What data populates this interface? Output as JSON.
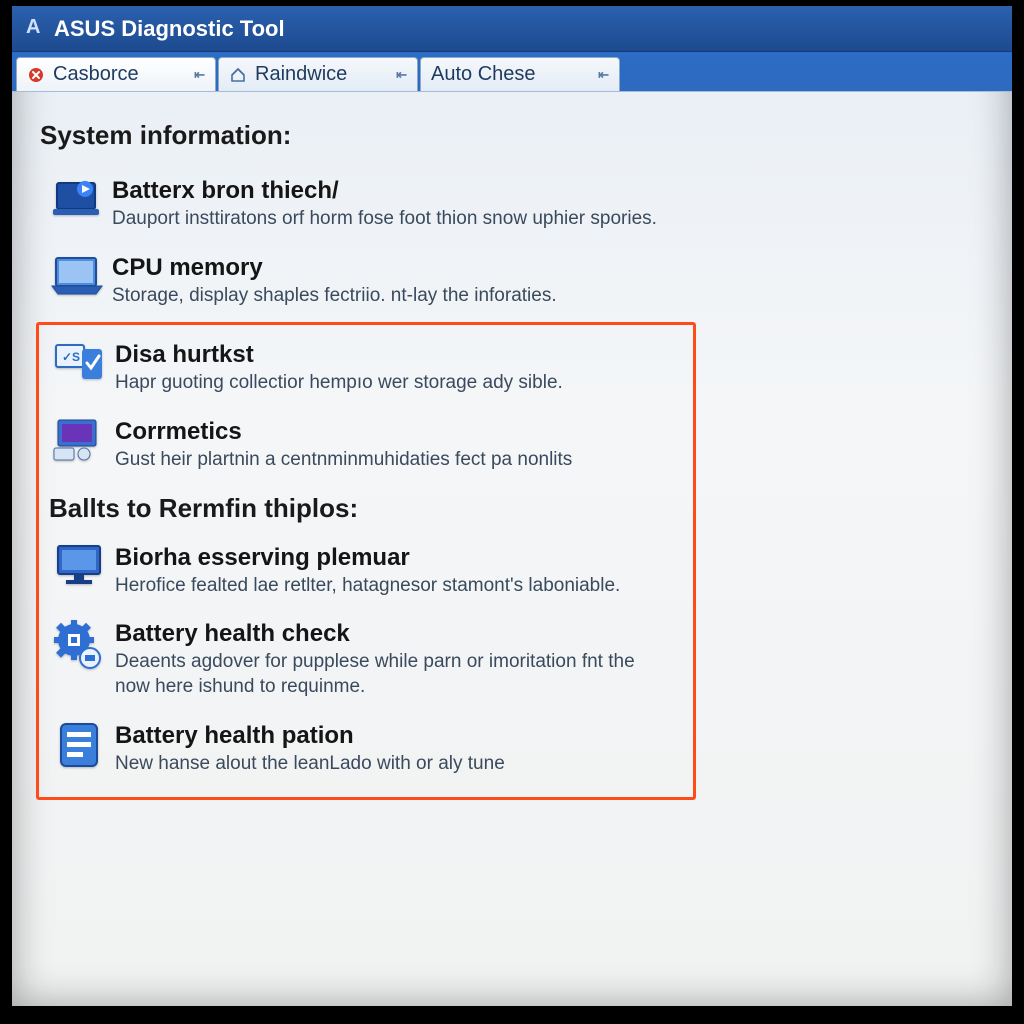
{
  "window": {
    "title": "ASUS Diagnostic Tool"
  },
  "tabs": [
    {
      "label": "Casborce",
      "icon": "close-red"
    },
    {
      "label": "Raindwice",
      "icon": "home"
    },
    {
      "label": "Auto Chese",
      "icon": "none"
    }
  ],
  "section1": {
    "heading": "System information:",
    "items": [
      {
        "icon": "laptop-play",
        "title": "Batterx bron thiech/",
        "desc": "Dauport insttiratons orf horm fose foot thion snow uphier spories."
      },
      {
        "icon": "laptop",
        "title": "CPU memory",
        "desc": "Storage, display shaples fectriio. nt-lay the inforaties."
      }
    ]
  },
  "highlighted": {
    "pre_items": [
      {
        "icon": "check-device",
        "title": "Disa hurtkst",
        "desc": "Hapr guoting collectior hempıo wer storage ady sible."
      },
      {
        "icon": "monitor-remote",
        "title": "Corrmetics",
        "desc": "Gust heir plartnin a centnminmuhidaties fect pa nonlits"
      }
    ],
    "heading": "Ballts to Rermfin thiplos:",
    "items": [
      {
        "icon": "monitor",
        "title": "Biorha esserving plemuar",
        "desc": "Herofice fealted lae retlter, hatagnesor stamont's laboniable."
      },
      {
        "icon": "gear-chip",
        "title": "Battery health check",
        "desc": "Deaents agdover for pupplese while parn or imoritation fnt the now here ishund to requinme."
      },
      {
        "icon": "list-card",
        "title": "Battery health pation",
        "desc": "New hanse alout the leanLado with or aly tune"
      }
    ]
  },
  "colors": {
    "accent": "#2b61af",
    "highlight": "#ff4a1a"
  }
}
